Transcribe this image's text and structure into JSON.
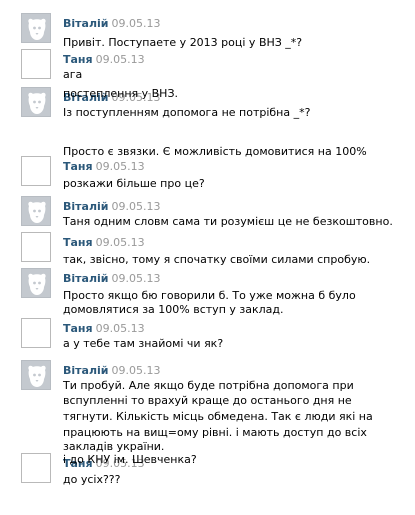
{
  "messages": [
    {
      "author": "Віталій",
      "date": "09.05.13",
      "avatar": "dog-avatar",
      "lines": [
        "Привіт. Поступаете у 2013 році у ВНЗ _*?"
      ]
    },
    {
      "author": "Таня",
      "date": "09.05.13",
      "avatar": "blank-avatar",
      "lines": [
        "ага"
      ]
    },
    {
      "author": "Віталій",
      "date": "09.05.13",
      "avatar": "dog-avatar",
      "lines": [
        "Із поступленням допомога не потрібна _*?",
        "",
        "Просто є звязки. Є можливість домовитися на 100%",
        "постеплення у ВНЗ."
      ]
    },
    {
      "author": "Таня",
      "date": "09.05.13",
      "avatar": "blank-avatar",
      "lines": [
        "розкажи більше про це?"
      ]
    },
    {
      "author": "Віталій",
      "date": "09.05.13",
      "avatar": "dog-avatar",
      "lines": [
        "Таня одним словм сама ти розумієш це не безкоштовно."
      ]
    },
    {
      "author": "Таня",
      "date": "09.05.13",
      "avatar": "blank-avatar",
      "lines": [
        "так, звісно, тому я спочатку своїми силами спробую."
      ]
    },
    {
      "author": "Віталій",
      "date": "09.05.13",
      "avatar": "dog-avatar",
      "lines": [
        "Просто якщо бю говорили б. То уже можна б було",
        "домовлятися за 100% вступ у заклад."
      ]
    },
    {
      "author": "Таня",
      "date": "09.05.13",
      "avatar": "blank-avatar",
      "lines": [
        "а у тебе там знайомі чи як?"
      ]
    },
    {
      "author": "Віталій",
      "date": "09.05.13",
      "avatar": "dog-avatar",
      "lines": [
        "Ти пробуй. Але якщо буде потрібна допомога при",
        "вспупленні то врахуй краще до останього дня не",
        "тягнути. Кількість місць обмедена. Так є люди які на",
        "працюють на вищ=ому рівні. і мають доступ до всіх",
        "закладів україни."
      ]
    },
    {
      "author": "Таня",
      "date": "09.05.13",
      "avatar": "blank-avatar",
      "lines": [
        "до усіх???",
        "",
        "і до КНУ ім. Шевченка?"
      ]
    }
  ]
}
